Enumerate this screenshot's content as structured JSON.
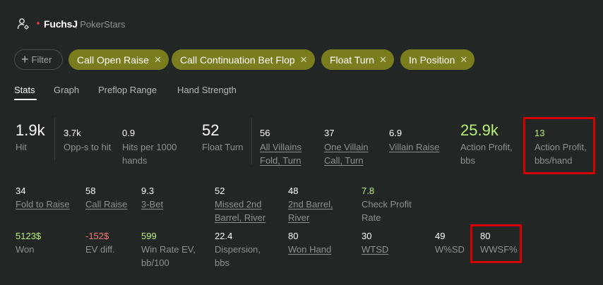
{
  "player": {
    "name": "FuchsJ",
    "site": ", PokerStars"
  },
  "filters": {
    "add_label": "Filter",
    "chips": [
      "Call Open Raise",
      "Call Continuation Bet Flop",
      "Float Turn",
      "In Position"
    ]
  },
  "tabs": [
    "Stats",
    "Graph",
    "Preflop Range",
    "Hand Strength"
  ],
  "stats": {
    "hit": {
      "value": "1.9k",
      "label": "Hit"
    },
    "opps": {
      "value": "3.7k",
      "label": "Opp-s to hit"
    },
    "hits_per_1000": {
      "value": "0.9",
      "label1": "Hits per 1000",
      "label2": "hands"
    },
    "float_turn": {
      "value": "52",
      "label": "Float Turn"
    },
    "all_villains": {
      "value": "56",
      "label1": "All Villains",
      "label2": "Fold, Turn"
    },
    "one_villain": {
      "value": "37",
      "label1": "One Villain",
      "label2": "Call, Turn"
    },
    "villain_raise": {
      "value": "6.9",
      "label": "Villain Raise"
    },
    "action_profit": {
      "value": "25.9k",
      "label1": "Action Profit,",
      "label2": "bbs"
    },
    "action_profit_hand": {
      "value": "13",
      "label1": "Action Profit,",
      "label2": "bbs/hand"
    },
    "fold_to_raise": {
      "value": "34",
      "label": "Fold to Raise"
    },
    "call_raise": {
      "value": "58",
      "label": "Call Raise"
    },
    "three_bet": {
      "value": "9.3",
      "label": "3-Bet"
    },
    "missed_2nd": {
      "value": "52",
      "label1": "Missed 2nd",
      "label2": "Barrel, River"
    },
    "second_barrel": {
      "value": "48",
      "label1": "2nd Barrel,",
      "label2": "River"
    },
    "check_profit": {
      "value": "7.8",
      "label1": "Check Profit",
      "label2": "Rate"
    },
    "won": {
      "value": "5123$",
      "label": "Won"
    },
    "ev_diff": {
      "value": "-152$",
      "label": "EV diff."
    },
    "win_rate_ev": {
      "value": "599",
      "label1": "Win Rate EV,",
      "label2": "bb/100"
    },
    "dispersion": {
      "value": "22.4",
      "label1": "Dispersion,",
      "label2": "bbs"
    },
    "won_hand": {
      "value": "80",
      "label": "Won Hand"
    },
    "wtsd": {
      "value": "30",
      "label": "WTSD"
    },
    "wsd": {
      "value": "49",
      "label": "W%SD"
    },
    "wwsf": {
      "value": "80",
      "label": "WWSF%"
    }
  },
  "colors": {
    "chip": "#7a7d1e",
    "positive": "#b9f07a",
    "negative": "#f07878",
    "highlight": "#d50000",
    "background": "#222624"
  }
}
